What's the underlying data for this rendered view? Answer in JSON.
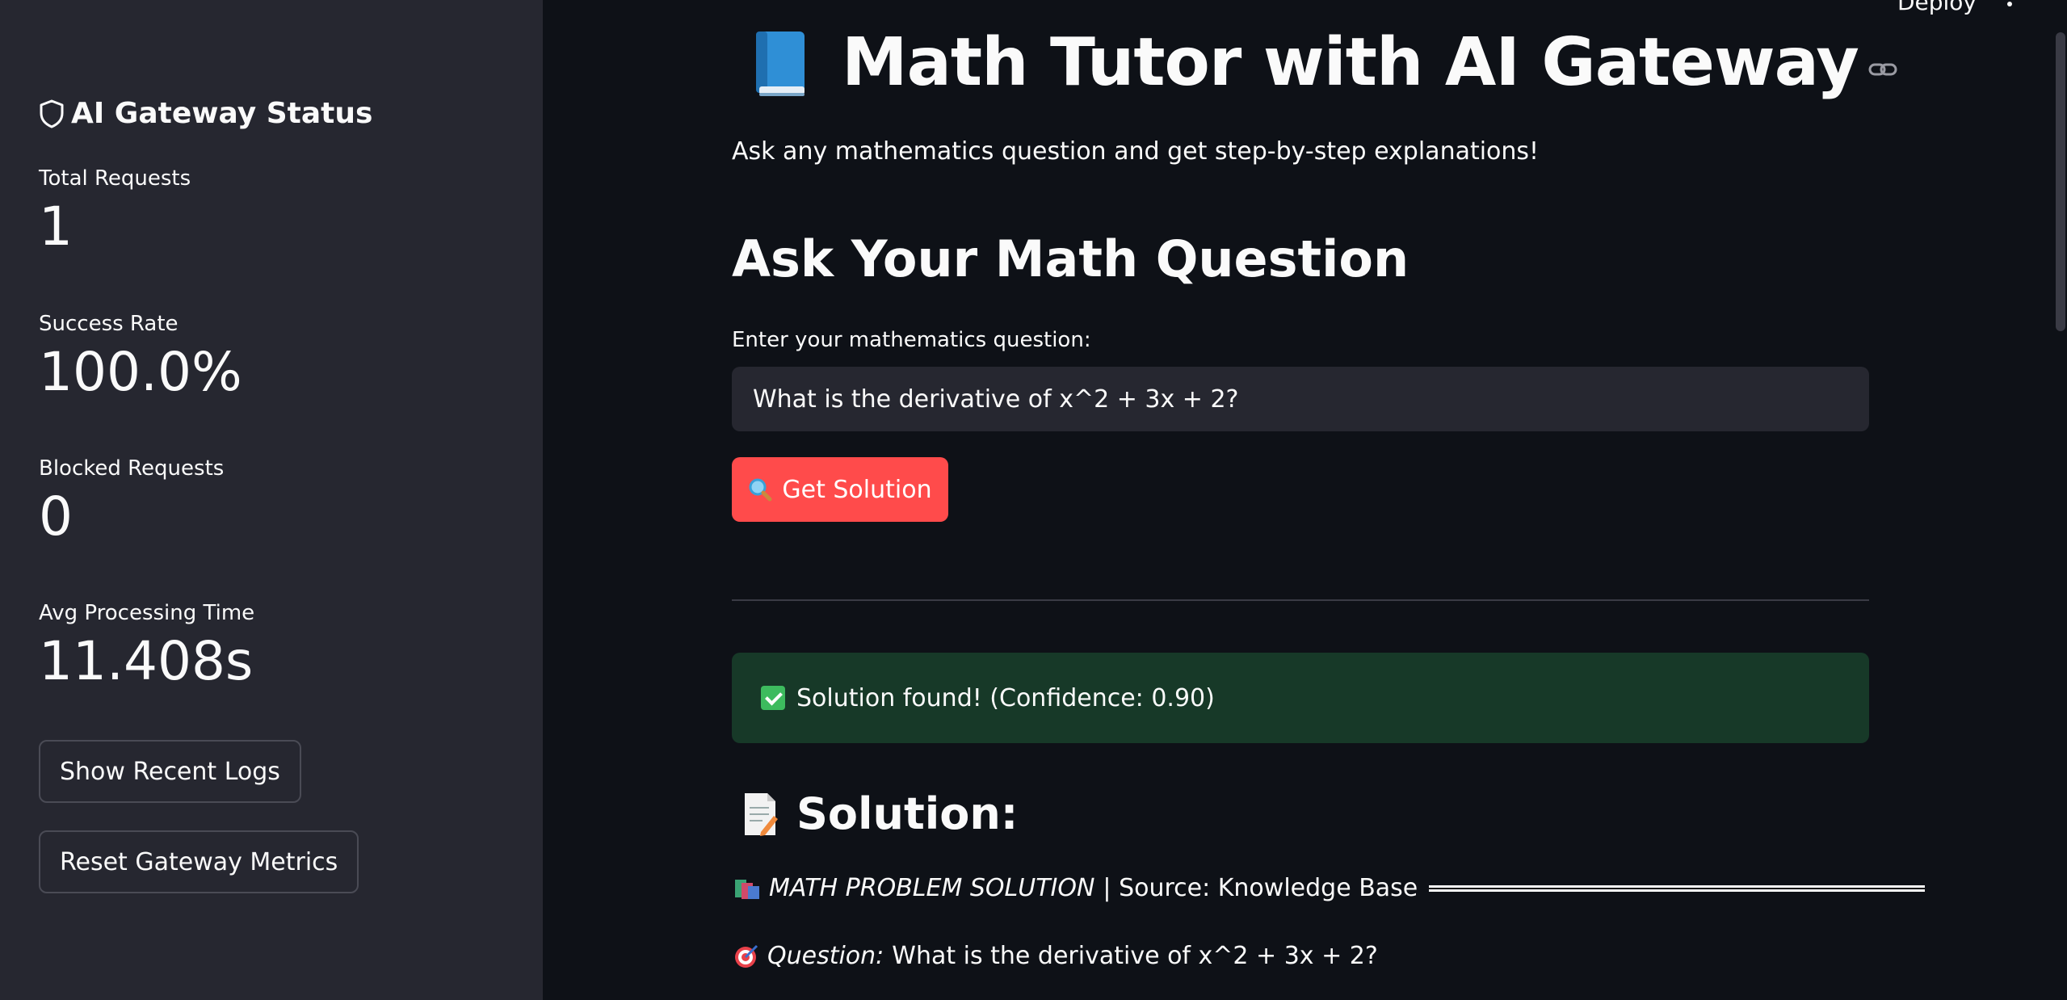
{
  "topbar": {
    "deploy_label": "Deploy"
  },
  "sidebar": {
    "title": "AI Gateway Status",
    "metrics": [
      {
        "label": "Total Requests",
        "value": "1"
      },
      {
        "label": "Success Rate",
        "value": "100.0%"
      },
      {
        "label": "Blocked Requests",
        "value": "0"
      },
      {
        "label": "Avg Processing Time",
        "value": "11.408s"
      }
    ],
    "buttons": {
      "show_logs": "Show Recent Logs",
      "reset_metrics": "Reset Gateway Metrics"
    }
  },
  "main": {
    "title": "Math Tutor with AI Gateway",
    "subtitle": "Ask any mathematics question and get step-by-step explanations!",
    "section_title": "Ask Your Math Question",
    "input": {
      "label": "Enter your mathematics question:",
      "value": "What is the derivative of x^2 + 3x + 2?"
    },
    "submit_label": "Get Solution",
    "success_message": "Solution found! (Confidence: 0.90)",
    "solution": {
      "heading": "Solution:",
      "header_italic": "MATH PROBLEM SOLUTION",
      "header_rest": "| Source: Knowledge Base",
      "question_label": "Question:",
      "question_text": "What is the derivative of x^2 + 3x + 2?"
    }
  },
  "colors": {
    "background": "#0e1117",
    "sidebar": "#262730",
    "primary": "#ff4b4b",
    "success_bg": "#173928"
  }
}
